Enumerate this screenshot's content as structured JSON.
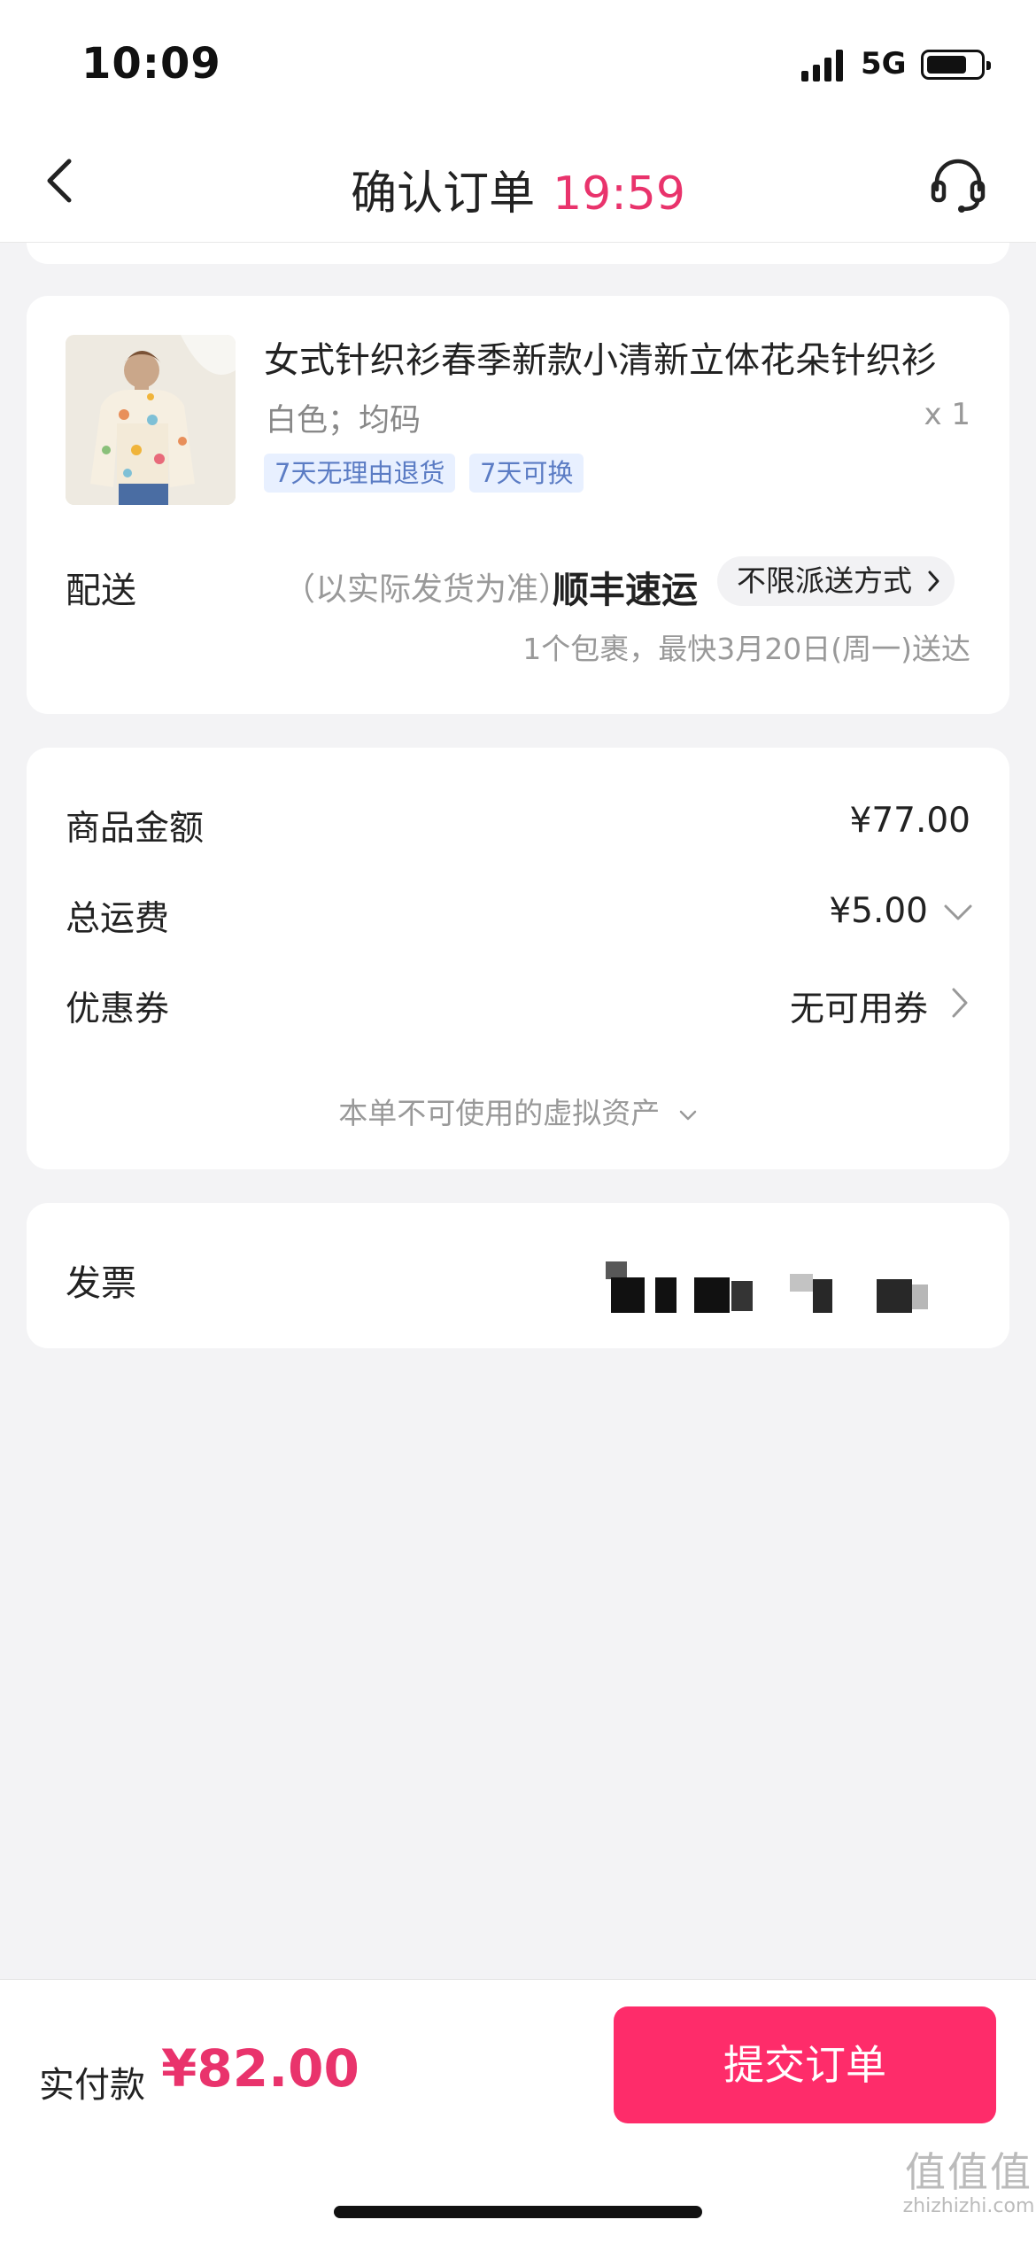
{
  "status_bar": {
    "time": "10:09",
    "network": "5G",
    "icons": [
      "signal-icon",
      "battery-icon"
    ]
  },
  "nav": {
    "title": "确认订单",
    "countdown": "19:59",
    "icons": [
      "back-chevron-icon",
      "headset-icon"
    ]
  },
  "product": {
    "image": "sweater-product-photo",
    "title": "女式针织衫春季新款小清新立体花朵针织衫",
    "spec": "白色；均码",
    "quantity": "x 1",
    "tags": [
      "7天无理由退货",
      "7天可换"
    ]
  },
  "shipping": {
    "label": "配送",
    "note": "（以实际发货为准）",
    "carrier": "顺丰速运",
    "option": "不限派送方式",
    "eta": "1个包裹，最快3月20日(周一)送达"
  },
  "pricing": {
    "goods_label": "商品金额",
    "goods_value": "¥77.00",
    "freight_label": "总运费",
    "freight_value": "¥5.00",
    "coupon_label": "优惠券",
    "coupon_value": "无可用券",
    "virtual_assets": "本单不可使用的虚拟资产"
  },
  "invoice": {
    "label": "发票"
  },
  "footer": {
    "pay_label": "实付款",
    "pay_amount": "¥82.00",
    "submit_label": "提交订单"
  },
  "watermark": {
    "symbol": "值值值",
    "url": "zhizhizhi.com"
  },
  "colors": {
    "accent": "#fe2c6a",
    "price": "#e9336c",
    "tag_bg": "#e8f0ff",
    "tag_text": "#5b7cc4",
    "page_bg": "#f3f3f5"
  }
}
